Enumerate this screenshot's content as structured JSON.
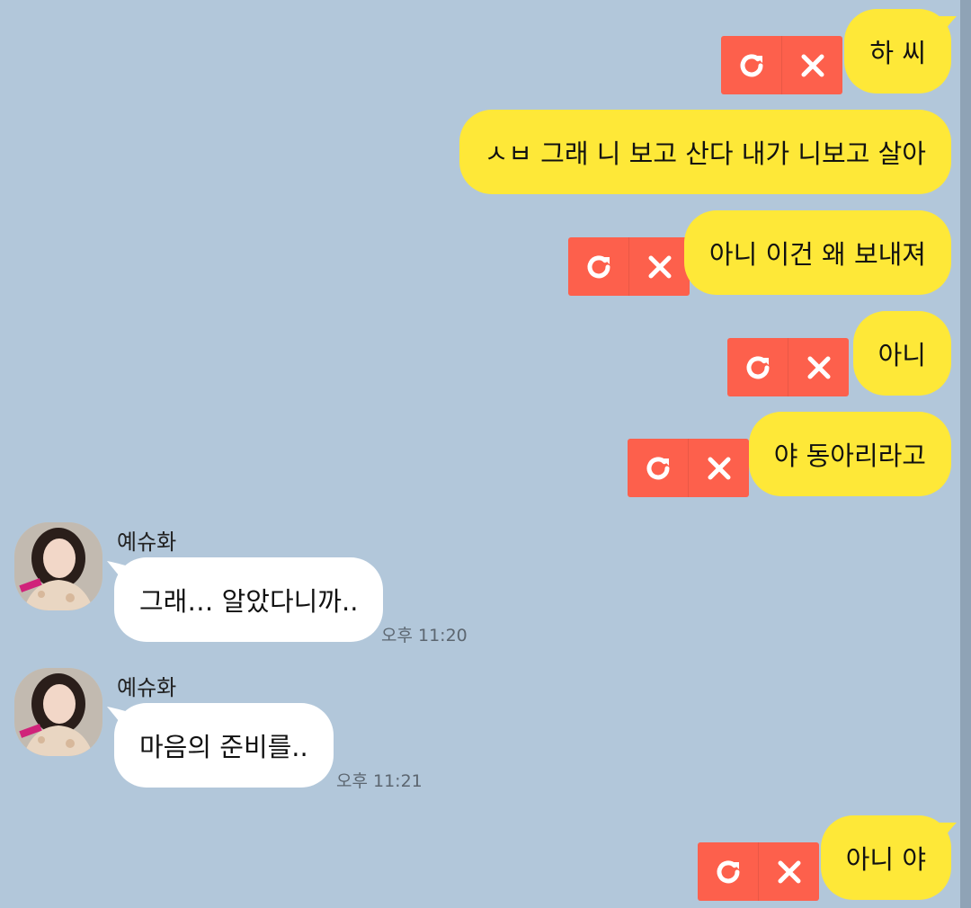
{
  "messages_sent": [
    {
      "text": "하 씨"
    },
    {
      "text": "ㅅㅂ 그래 니 보고 산다 내가 니보고 살아"
    },
    {
      "text": "아니 이건 왜 보내져"
    },
    {
      "text": "아니"
    },
    {
      "text": "야 동아리라고"
    },
    {
      "text": "아니 야"
    }
  ],
  "messages_received": [
    {
      "sender": "예슈화",
      "text": "그래… 알았다니까..",
      "time": "오후 11:20"
    },
    {
      "sender": "예슈화",
      "text": "마음의 준비를..",
      "time": "오후 11:21"
    }
  ],
  "icons": {
    "resend": "resend-icon",
    "delete": "close-icon"
  },
  "colors": {
    "background": "#b2c7da",
    "my_bubble": "#fee838",
    "other_bubble": "#ffffff",
    "failed_action": "#fd604c"
  }
}
